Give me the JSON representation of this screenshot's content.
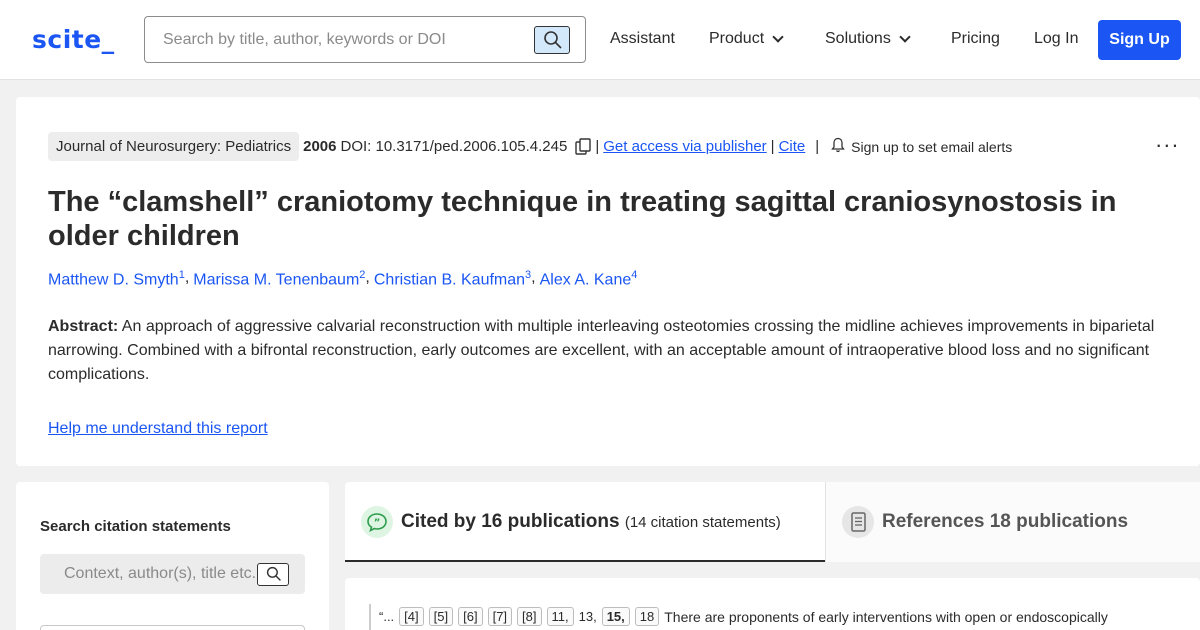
{
  "header": {
    "logo": "scite_",
    "search_placeholder": "Search by title, author, keywords or DOI",
    "nav": {
      "assistant": "Assistant",
      "product": "Product",
      "solutions": "Solutions",
      "pricing": "Pricing",
      "login": "Log In",
      "signup": "Sign Up"
    }
  },
  "paper": {
    "journal": "Journal of Neurosurgery: Pediatrics",
    "year": "2006",
    "doi": "DOI: 10.3171/ped.2006.105.4.245",
    "separator": "|",
    "access_link": "Get access via publisher",
    "cite_link": "Cite",
    "alerts": "Sign up to set email alerts",
    "more": "...",
    "title": "The “clamshell” craniotomy technique in treating sagittal craniosynostosis in older children",
    "authors": [
      {
        "name": "Matthew D. Smyth",
        "sup": "1"
      },
      {
        "name": "Marissa M. Tenenbaum",
        "sup": "2"
      },
      {
        "name": "Christian B. Kaufman",
        "sup": "3"
      },
      {
        "name": "Alex A. Kane",
        "sup": "4"
      }
    ],
    "abstract_label": "Abstract:",
    "abstract_text": "An approach of aggressive calvarial reconstruction with multiple interleaving osteotomies crossing the midline achieves improvements in biparietal narrowing. Combined with a bifrontal reconstruction, early outcomes are excellent, with an acceptable amount of intraoperative blood loss and no significant complications.",
    "help_link": "Help me understand this report"
  },
  "sidebar": {
    "title": "Search citation statements",
    "search_placeholder": "Context, author(s), title etc."
  },
  "tabs": {
    "cited_label": "Cited by 16 publications",
    "cited_sub": "(14 citation statements)",
    "refs_label": "References 18 publications"
  },
  "statement": {
    "lead": "“...",
    "refs": [
      "[4]",
      "[5]",
      "[6]",
      "[7]",
      "[8]",
      "11,",
      "13,",
      "15,",
      "18"
    ],
    "text": "There are proponents of early interventions with open or endoscopically"
  },
  "colors": {
    "brand": "#1b56f4",
    "tab_icon_green": "#dff5e4"
  },
  "icons": [
    "search-icon",
    "chevron-down-icon",
    "copy-icon",
    "bell-icon",
    "more-icon",
    "quote-icon",
    "document-icon"
  ]
}
